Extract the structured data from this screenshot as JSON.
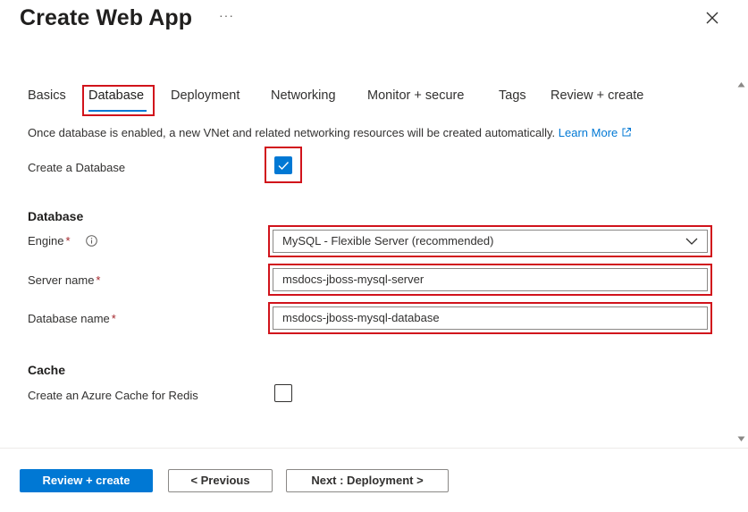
{
  "header": {
    "title": "Create Web App",
    "more_label": "···",
    "close_icon": "close-icon"
  },
  "tabs": [
    {
      "label": "Basics"
    },
    {
      "label": "Database"
    },
    {
      "label": "Deployment"
    },
    {
      "label": "Networking"
    },
    {
      "label": "Monitor + secure"
    },
    {
      "label": "Tags"
    },
    {
      "label": "Review + create"
    }
  ],
  "active_tab": "Database",
  "info": {
    "text": "Once database is enabled, a new VNet and related networking resources will be created automatically.",
    "learn_more": "Learn More"
  },
  "create_database": {
    "label": "Create a Database",
    "checked": true
  },
  "database_section": {
    "heading": "Database",
    "engine": {
      "label": "Engine",
      "required": "*",
      "value": "MySQL - Flexible Server (recommended)"
    },
    "server_name": {
      "label": "Server name",
      "required": "*",
      "value": "msdocs-jboss-mysql-server"
    },
    "database_name": {
      "label": "Database name",
      "required": "*",
      "value": "msdocs-jboss-mysql-database"
    }
  },
  "cache_section": {
    "heading": "Cache",
    "redis": {
      "label": "Create an Azure Cache for Redis",
      "checked": false
    }
  },
  "footer": {
    "review_create": "Review + create",
    "previous": "< Previous",
    "next": "Next : Deployment >"
  },
  "colors": {
    "accent": "#0078d4",
    "highlight_border": "#d1131b",
    "required": "#a4262c"
  }
}
